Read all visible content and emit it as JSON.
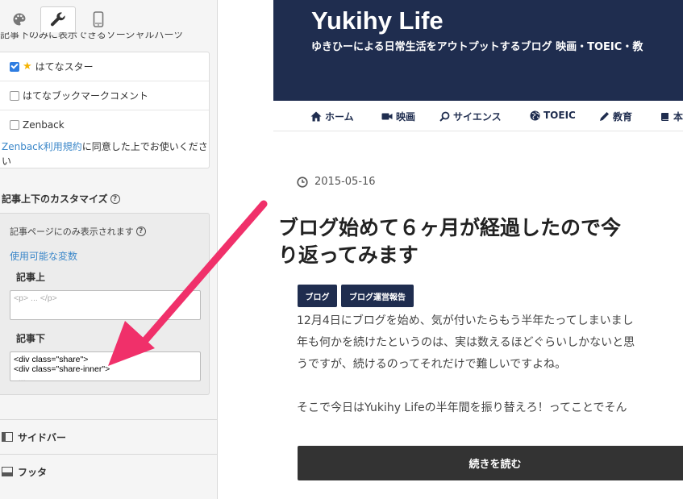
{
  "left_panel": {
    "cut_off_text": "記事下のみに表示できるソーシャルパーツ",
    "social_options": [
      {
        "label": "はてなスター",
        "checked": true,
        "icon": "star-icon"
      },
      {
        "label": "はてなブックマークコメント",
        "checked": false
      },
      {
        "label": "Zenback",
        "checked": false
      }
    ],
    "zenback_link": "Zenback利用規約",
    "zenback_notice": "に同意した上でお使いください",
    "custom_section_title": "記事上下のカスタマイズ",
    "custom_note": "記事ページにのみ表示されます",
    "variables_link": "使用可能な変数",
    "above_label": "記事上",
    "above_placeholder": "<p> ... </p>",
    "below_label": "記事下",
    "below_value": "<div class=\"share\">\n<div class=\"share-inner\">\n  ...",
    "sidebar_label": "サイドバー",
    "footer_label": "フッタ"
  },
  "blog": {
    "title": "Yukihy Life",
    "description": "ゆきひーによる日常生活をアウトプットするブログ 映画・TOEIC・教",
    "nav": [
      {
        "label": "ホーム",
        "icon": "home-icon"
      },
      {
        "label": "映画",
        "icon": "video-camera-icon"
      },
      {
        "label": "サイエンス",
        "icon": "search-icon"
      },
      {
        "label": "TOEIC",
        "icon": "globe-icon"
      },
      {
        "label": "教育",
        "icon": "pencil-icon"
      },
      {
        "label": "本",
        "icon": "book-icon"
      }
    ],
    "post": {
      "date": "2015-05-16",
      "title_line1": "ブログ始めて６ヶ月が経過したので今",
      "title_line2": "り返ってみます",
      "categories": [
        "ブログ",
        "ブログ運営報告"
      ],
      "body_lines": [
        "12月4日にブログを始め、気が付いたらもう半年たってしまいまし",
        "年も何かを続けたというのは、実は数えるほどぐらいしかないと思",
        "うですが、続けるのってそれだけで難しいですよね。"
      ],
      "body_line2": "そこで今日はYukihy Lifeの半年間を振り替えろ！ってことでそん",
      "read_more": "続きを読む"
    }
  },
  "colors": {
    "header_bg": "#1f2d4f",
    "arrow": "#f0306a",
    "link": "#3b87c9"
  }
}
